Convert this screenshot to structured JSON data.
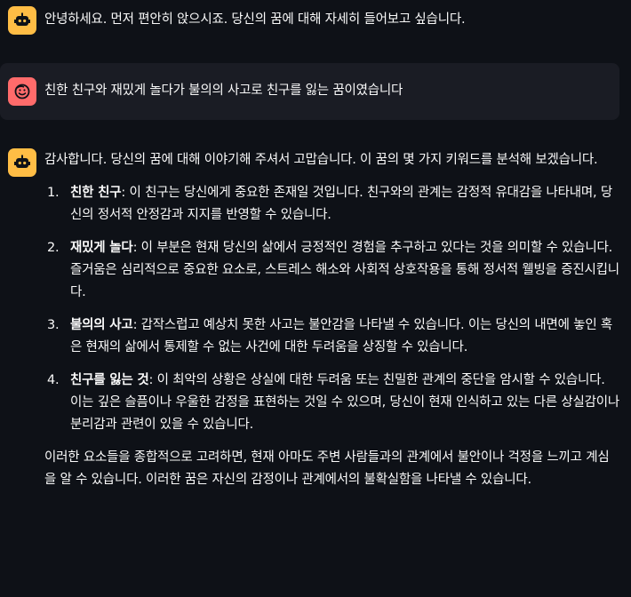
{
  "messages": [
    {
      "role": "assistant",
      "avatar": "bot-icon",
      "text": "안녕하세요. 먼저 편안히 앉으시죠. 당신의 꿈에 대해 자세히 들어보고 싶습니다."
    },
    {
      "role": "user",
      "avatar": "smiley-icon",
      "text": "친한 친구와 재밌게 놀다가 불의의 사고로 친구를 잃는 꿈이였습니다"
    },
    {
      "role": "assistant",
      "avatar": "bot-icon",
      "intro": "감사합니다. 당신의 꿈에 대해 이야기해 주셔서 고맙습니다. 이 꿈의 몇 가지 키워드를 분석해 보겠습니다.",
      "items": [
        {
          "num": "1.",
          "keyword": "친한 친구",
          "desc": ": 이 친구는 당신에게 중요한 존재일 것입니다. 친구와의 관계는 감정적 유대감을 나타내며, 당신의 정서적 안정감과 지지를 반영할 수 있습니다."
        },
        {
          "num": "2.",
          "keyword": "재밌게 놀다",
          "desc": ": 이 부분은 현재 당신의 삶에서 긍정적인 경험을 추구하고 있다는 것을 의미할 수 있습니다. 즐거움은 심리적으로 중요한 요소로, 스트레스 해소와 사회적 상호작용을 통해 정서적 웰빙을 증진시킵니다."
        },
        {
          "num": "3.",
          "keyword": "불의의 사고",
          "desc": ": 갑작스럽고 예상치 못한 사고는 불안감을 나타낼 수 있습니다. 이는 당신의 내면에 놓인 혹은 현재의 삶에서 통제할 수 없는 사건에 대한 두려움을 상징할 수 있습니다."
        },
        {
          "num": "4.",
          "keyword": "친구를 잃는 것",
          "desc": ": 이 최악의 상황은 상실에 대한 두려움 또는 친밀한 관계의 중단을 암시할 수 있습니다. 이는 깊은 슬픔이나 우울한 감정을 표현하는 것일 수 있으며, 당신이 현재 인식하고 있는 다른 상실감이나 분리감과 관련이 있을 수 있습니다."
        }
      ],
      "conclusion": "이러한 요소들을 종합적으로 고려하면, 현재 아마도 주변 사람들과의 관계에서 불안이나 걱정을 느끼고 계심을 알 수 있습니다. 이러한 꿈은 자신의 감정이나 관계에서의 불확실함을 나타낼 수 있습니다."
    }
  ],
  "colors": {
    "background": "#0e1117",
    "user_row": "#1a1c24",
    "bot_avatar": "#ffbd45",
    "user_avatar": "#ff6b6b",
    "text": "#fafafa"
  }
}
